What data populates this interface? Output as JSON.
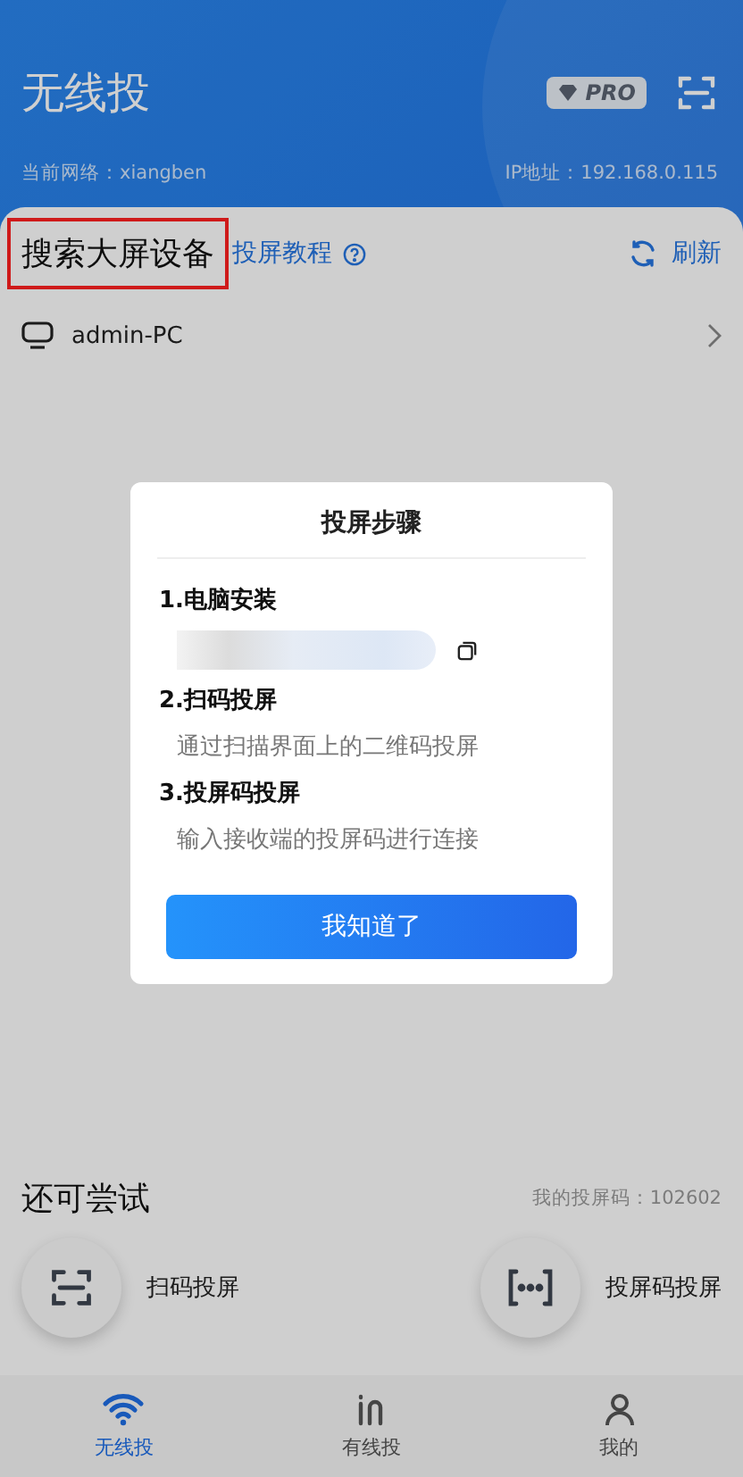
{
  "header": {
    "title": "无线投",
    "pro_badge": "PRO",
    "network": "当前网络：xiangben",
    "ip": "IP地址：192.168.0.115"
  },
  "search": {
    "title": "搜索大屏设备",
    "highlighted": true,
    "tutorial": "投屏教程",
    "refresh": "刷新"
  },
  "devices": [
    {
      "name": "admin-PC"
    }
  ],
  "dialog": {
    "title": "投屏步骤",
    "button": "我知道了",
    "steps": [
      {
        "kind": "download",
        "title": "1.电脑安装"
      },
      {
        "kind": "text",
        "title": "2.扫码投屏",
        "description": "通过扫描界面上的二维码投屏"
      },
      {
        "kind": "text",
        "title": "3.投屏码投屏",
        "description": "输入接收端的投屏码进行连接"
      }
    ]
  },
  "try_more": {
    "title": "还可尝试",
    "code": "我的投屏码：102602",
    "actions": [
      {
        "kind": "scan",
        "label": "扫码投屏"
      },
      {
        "kind": "code",
        "label": "投屏码投屏"
      }
    ]
  },
  "tabs": [
    {
      "kind": "wifi",
      "label": "无线投",
      "selected": true
    },
    {
      "kind": "cable",
      "label": "有线投",
      "selected": false
    },
    {
      "kind": "user",
      "label": "我的",
      "selected": false
    }
  ]
}
